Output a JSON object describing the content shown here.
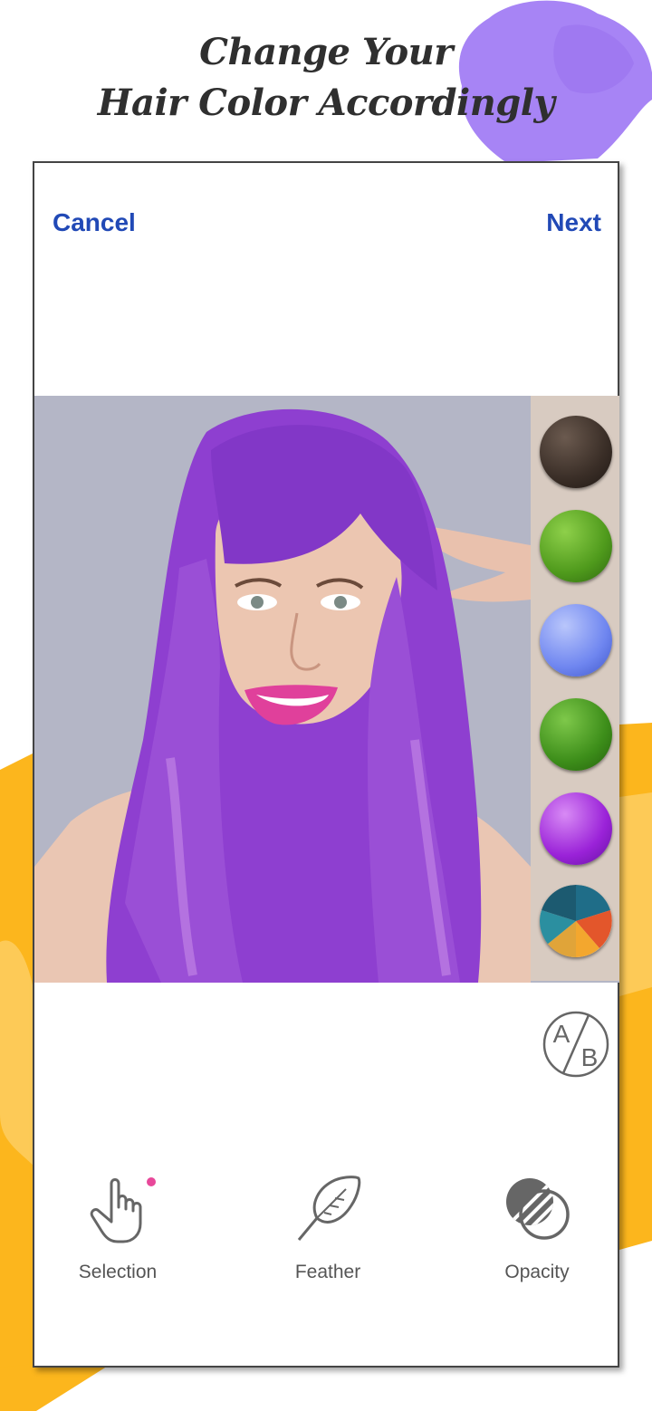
{
  "headline": {
    "line1": "Change Your",
    "line2": "Hair Color Accordingly"
  },
  "topbar": {
    "cancel_label": "Cancel",
    "next_label": "Next"
  },
  "palette": {
    "swatches": [
      {
        "name": "dark-brown",
        "color": "#3a2e27"
      },
      {
        "name": "green",
        "color": "#4f9a1c"
      },
      {
        "name": "light-blue",
        "color": "#6f86f0"
      },
      {
        "name": "green-2",
        "color": "#3d8e1a"
      },
      {
        "name": "violet",
        "color": "#9a22d8"
      },
      {
        "name": "multi-color",
        "colors": [
          "#1f6d88",
          "#e3562b",
          "#f3a72e",
          "#e0a439",
          "#2b8fa0"
        ]
      }
    ]
  },
  "compare_button": {
    "top": "A",
    "bottom": "B"
  },
  "tools": [
    {
      "label": "Selection",
      "icon": "hand-pointer-icon"
    },
    {
      "label": "Feather",
      "icon": "feather-icon"
    },
    {
      "label": "Opacity",
      "icon": "opacity-icon"
    }
  ],
  "colors": {
    "accent": "#2149b6",
    "badge": "#e8489a",
    "hair": "#8e3fd0",
    "yellow": "#fcb61d",
    "purple_splash": "#a784f5"
  }
}
